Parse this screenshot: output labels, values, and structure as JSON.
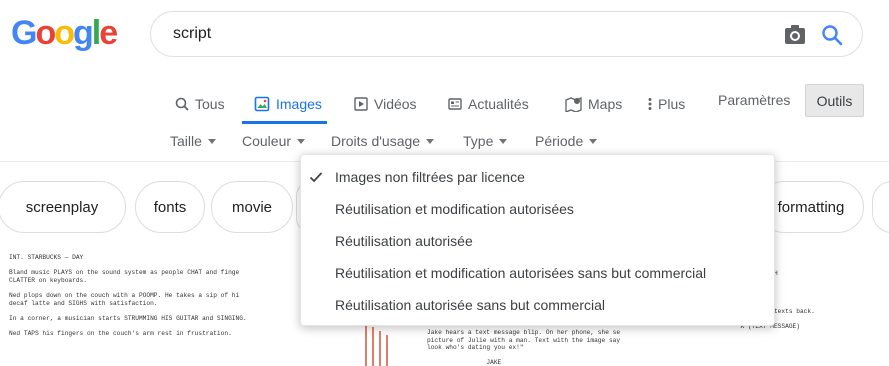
{
  "logo": {
    "letters": [
      "G",
      "o",
      "o",
      "g",
      "l",
      "e"
    ],
    "colors": [
      "#4285F4",
      "#EA4335",
      "#FBBC05",
      "#4285F4",
      "#34A853",
      "#EA4335"
    ]
  },
  "search": {
    "value": "script",
    "camera_icon": "camera-icon",
    "search_icon": "search-icon"
  },
  "tabs": [
    {
      "label": "Tous",
      "icon": "search-icon"
    },
    {
      "label": "Images",
      "icon": "image-icon",
      "active": true
    },
    {
      "label": "Vidéos",
      "icon": "play-icon"
    },
    {
      "label": "Actualités",
      "icon": "news-icon"
    },
    {
      "label": "Maps",
      "icon": "map-pin-icon"
    },
    {
      "label": "Plus",
      "icon": "more-vert-icon"
    }
  ],
  "settings_label": "Paramètres",
  "tools_label": "Outils",
  "filters": [
    "Taille",
    "Couleur",
    "Droits d'usage",
    "Type",
    "Période"
  ],
  "chips": [
    "screenplay",
    "fonts",
    "movie",
    "formatting"
  ],
  "license_menu": {
    "items": [
      {
        "label": "Images non filtrées par licence",
        "checked": true
      },
      {
        "label": "Réutilisation et modification autorisées"
      },
      {
        "label": "Réutilisation autorisée"
      },
      {
        "label": "Réutilisation et modification autorisées sans but commercial"
      },
      {
        "label": "Réutilisation autorisée sans but commercial"
      }
    ]
  },
  "thumbnails": {
    "left": "INT. STARBUCKS — DAY\n\nBland music PLAYS on the sound system as people CHAT and finge\nCLATTER on keyboards.\n\nNed plops down on the couch with a POOMP. He takes a sip of hi\ndecaf latte and SIGHS with satisfaction.\n\nIn a corner, a musician starts STRUMMING HIS GUITAR and SINGING.\n\nNed TAPS his fingers on the couch's arm rest in frustration.",
    "middle": "Jake hears a text message blip. On her phone, she sees a\npicture of Julie with a man. Text with the image says \"OMG,\nlook who's dating you ex!\"\n\n                JAKE\n        I'm fine, thank you.",
    "right": "DRIVING)\n\nowntown at speed. Her CELL PH\nhe picks it up and reads a t\n\nNDA (TEXT MESSAGE)\n\nWithout slowing down, Uneek texts back.\n\n               UNEEK (TEXT MESSAGE)"
  }
}
